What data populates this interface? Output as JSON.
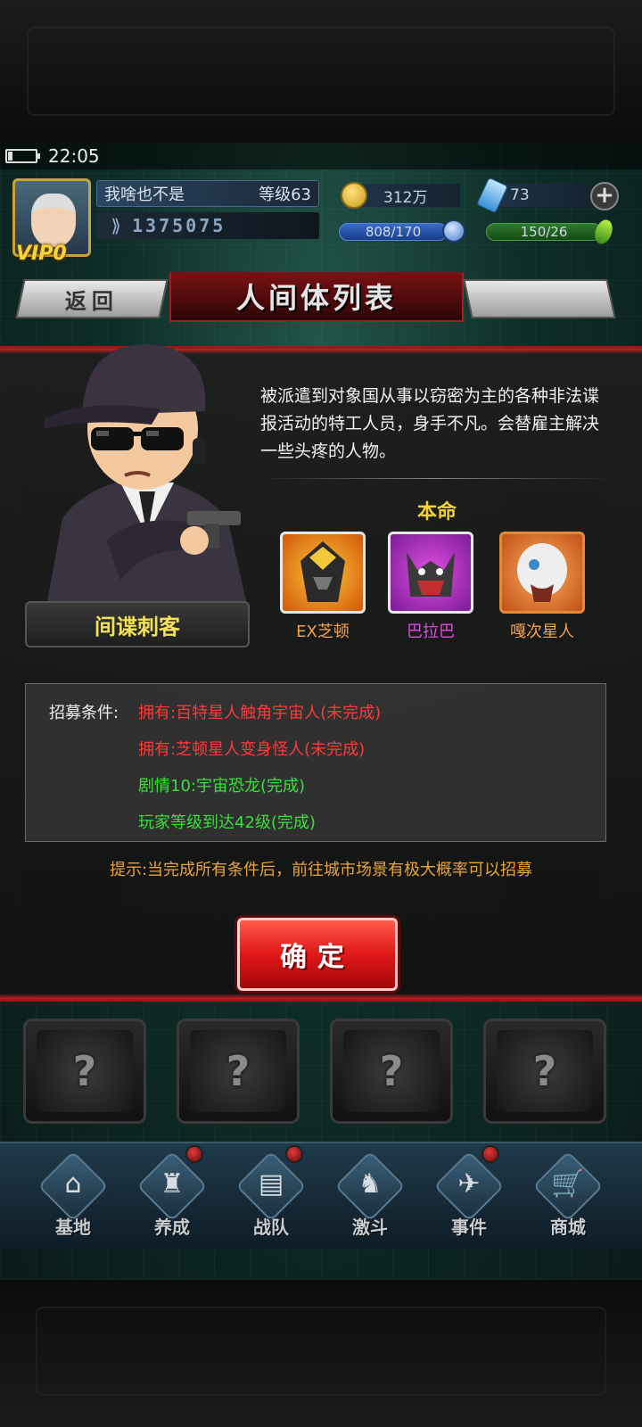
{
  "status": {
    "time": "22:05"
  },
  "player": {
    "name": "我啥也不是",
    "level": "等级63",
    "vip": "VIP0",
    "power": "1375075",
    "gold": "312万",
    "diamonds": "73",
    "stamina": "808/170",
    "energy": "150/26"
  },
  "header": {
    "back_label": "返回",
    "title": "人间体列表"
  },
  "character": {
    "name": "间谍刺客",
    "description": "被派遣到对象国从事以窃密为主的各种非法谍报活动的特工人员，身手不凡。会替雇主解决一些头疼的人物。"
  },
  "fate": {
    "label": "本命",
    "items": [
      {
        "name": "EX芝顿",
        "color": "#f3a04a"
      },
      {
        "name": "巴拉巴",
        "color": "#e04ae0"
      },
      {
        "name": "嘎次星人",
        "color": "#f3a04a"
      }
    ]
  },
  "recruit": {
    "label": "招募条件:",
    "conditions": [
      {
        "text": "拥有:百特星人触角宇宙人(未完成)",
        "color": "#ff3a3a"
      },
      {
        "text": "拥有:芝顿星人变身怪人(未完成)",
        "color": "#ff3a3a"
      },
      {
        "text": "剧情10:宇宙恐龙(完成)",
        "color": "#3ae03a"
      },
      {
        "text": "玩家等级到达42级(完成)",
        "color": "#3ae03a"
      }
    ],
    "tip": "提示:当完成所有条件后，前往城市场景有极大概率可以招募"
  },
  "confirm_label": "确定",
  "nav": {
    "items": [
      {
        "label": "基地",
        "icon": "base-icon"
      },
      {
        "label": "养成",
        "icon": "trophy-icon"
      },
      {
        "label": "战队",
        "icon": "cards-icon"
      },
      {
        "label": "激斗",
        "icon": "fighter-icon"
      },
      {
        "label": "事件",
        "icon": "event-icon"
      },
      {
        "label": "商城",
        "icon": "cart-icon"
      }
    ]
  }
}
